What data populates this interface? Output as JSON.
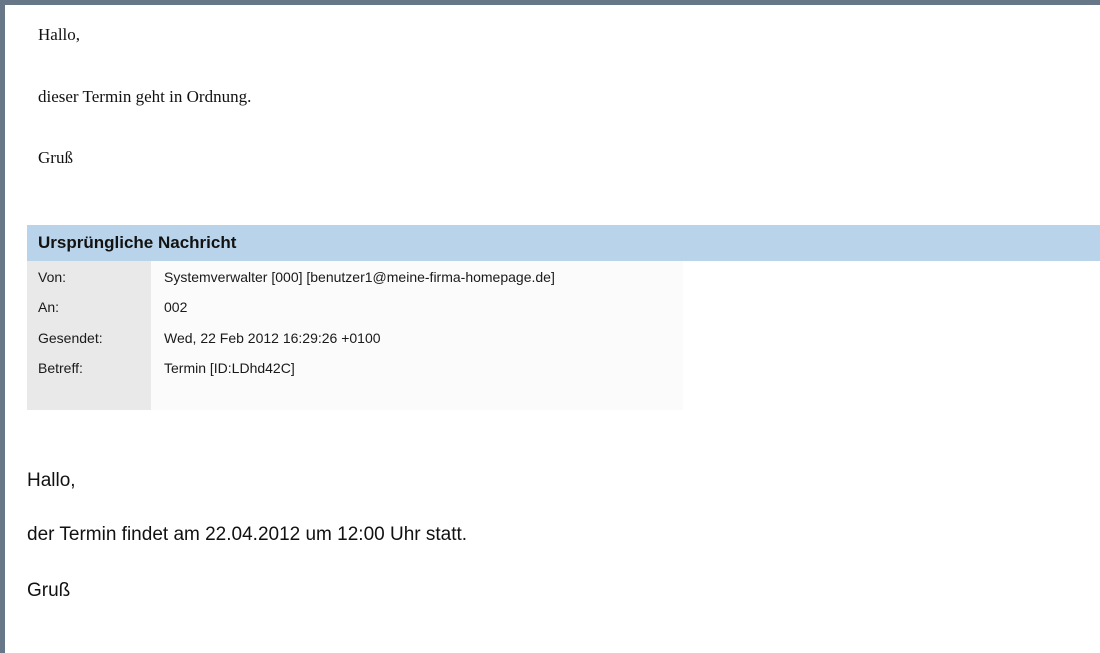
{
  "reply": {
    "greeting": "Hallo,",
    "message": "dieser Termin geht in Ordnung.",
    "closing": "Gruß"
  },
  "original_message": {
    "header_title": "Ursprüngliche Nachricht",
    "fields": [
      {
        "label": "Von:",
        "value": "Systemverwalter [000] [benutzer1@meine-firma-homepage.de]"
      },
      {
        "label": "An:",
        "value": "002"
      },
      {
        "label": "Gesendet:",
        "value": "Wed, 22 Feb 2012 16:29:26 +0100"
      },
      {
        "label": "Betreff:",
        "value": "Termin [ID:LDhd42C]"
      }
    ],
    "body": {
      "greeting": "Hallo,",
      "message": "der Termin findet am 22.04.2012 um 12:00 Uhr statt.",
      "closing": "Gruß"
    }
  },
  "colors": {
    "frame_border": "#687787",
    "header_band": "#b9d4ea",
    "label_column": "#e9e9e9"
  }
}
